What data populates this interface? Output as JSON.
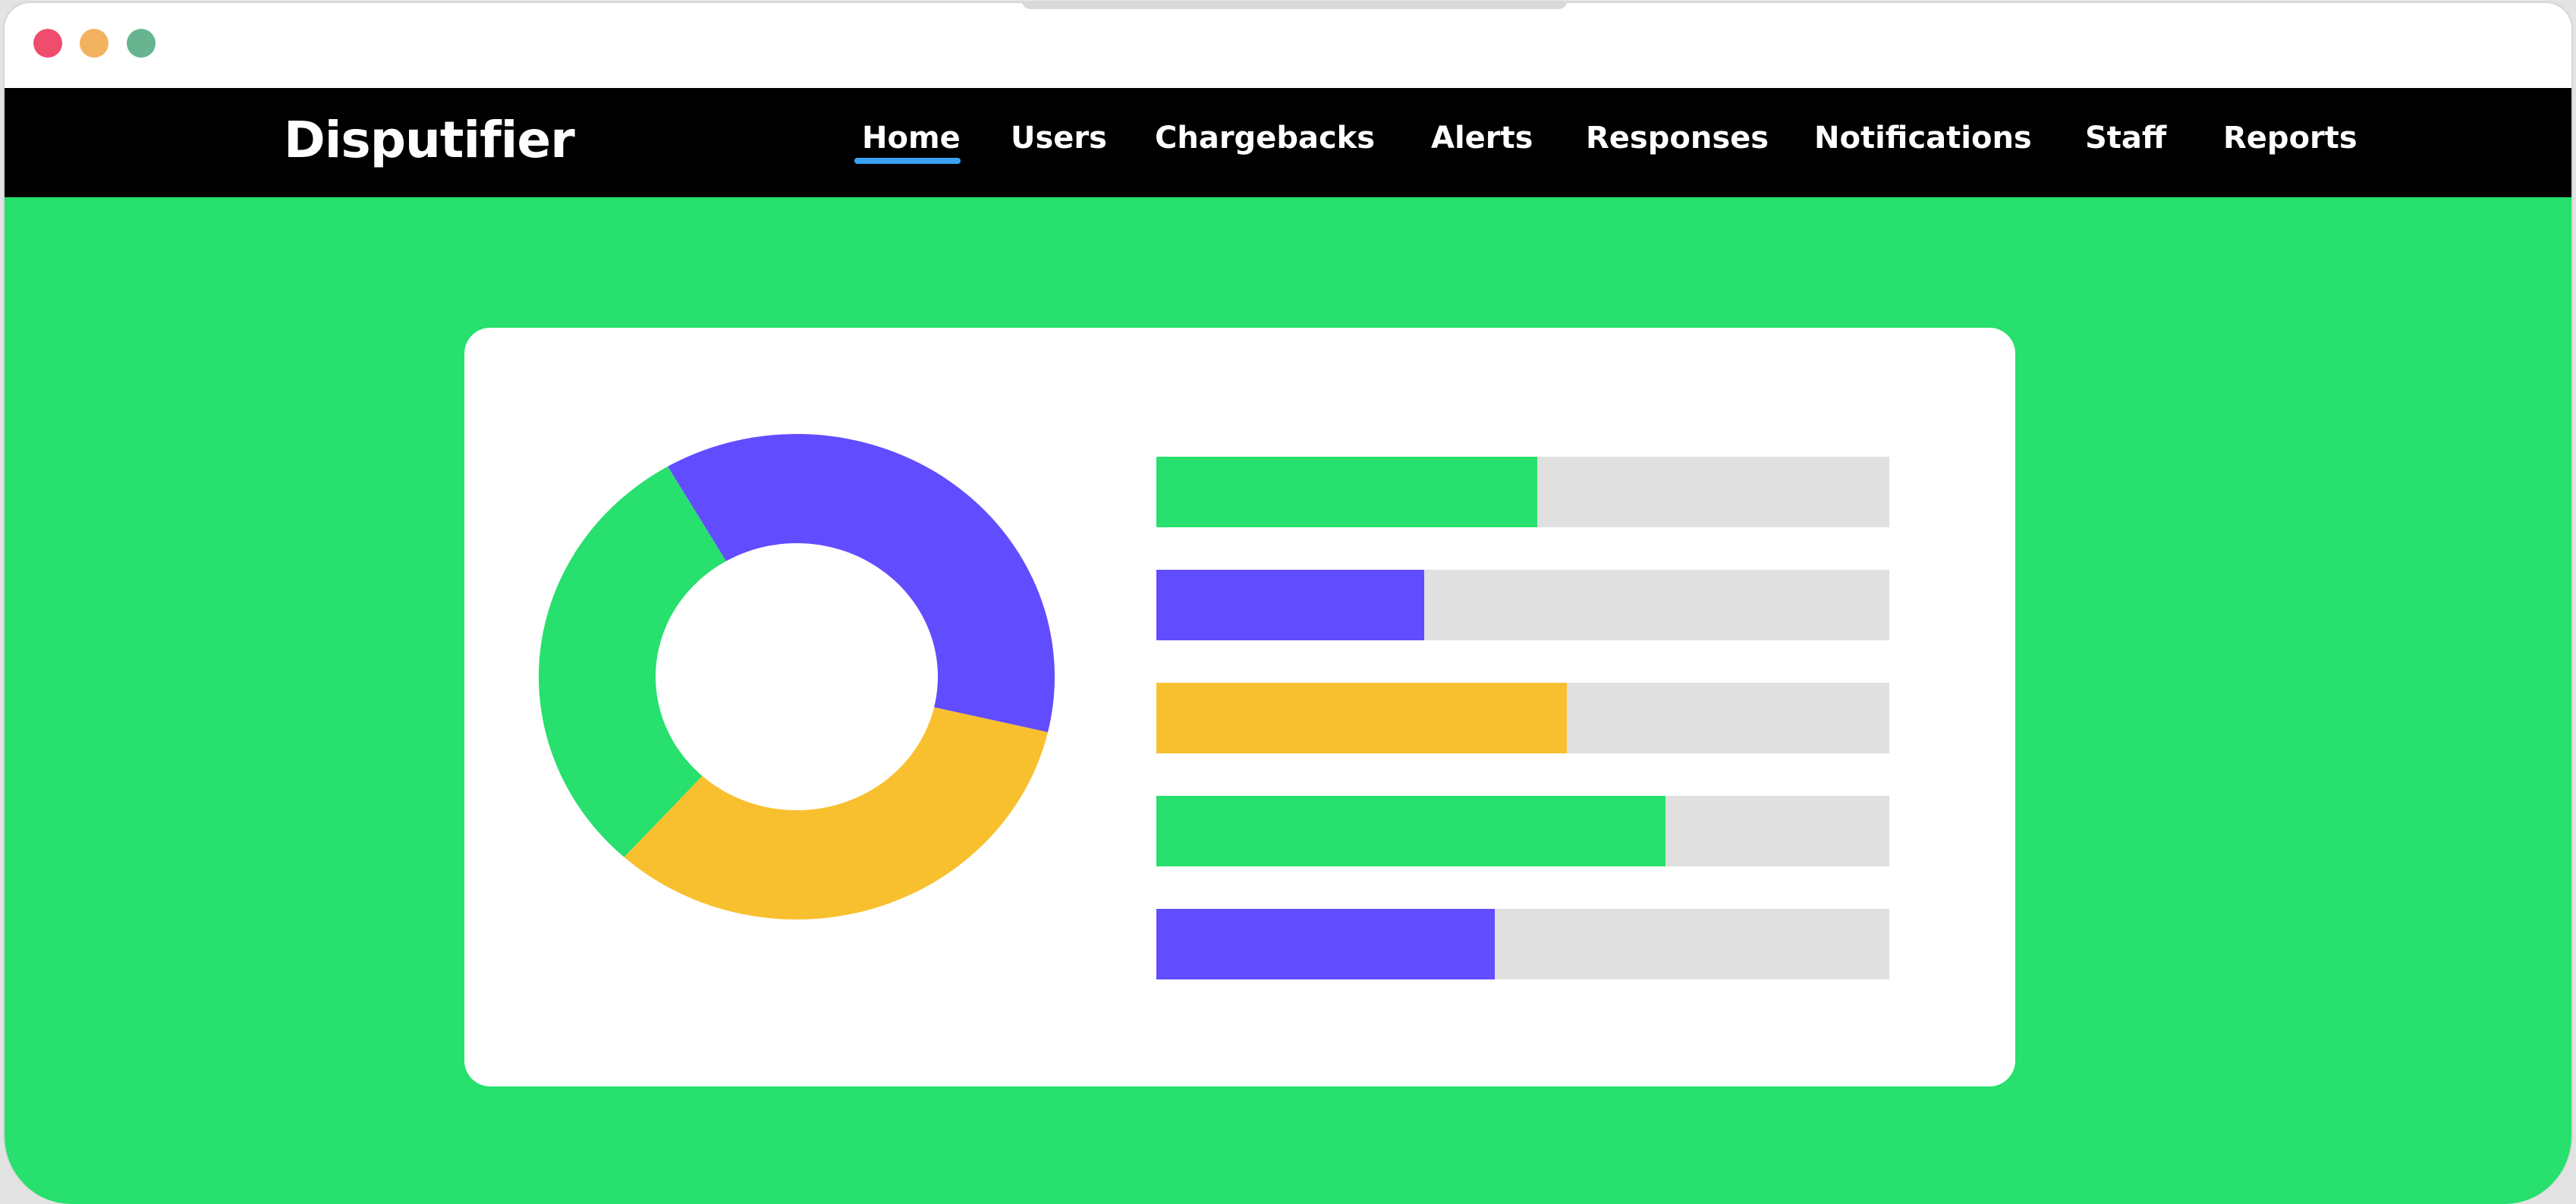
{
  "colors": {
    "page_background": "#27e06d",
    "navbar_background": "#000000",
    "accent_underline": "#3aa2f4",
    "track": "#e0e0e0",
    "green": "#27e06d",
    "purple": "#624cff",
    "yellow": "#f8c02e",
    "window_dot_red": "#ef4c6e",
    "window_dot_yellow": "#f3b260",
    "window_dot_green": "#66b490"
  },
  "window_controls": [
    {
      "name": "close-dot",
      "color": "#ef4c6e"
    },
    {
      "name": "minimize-dot",
      "color": "#f3b260"
    },
    {
      "name": "maximize-dot",
      "color": "#66b490"
    }
  ],
  "brand": "Disputifier",
  "nav": {
    "active": "Home",
    "items": [
      "Home",
      "Users",
      "Chargebacks",
      "Alerts",
      "Responses",
      "Notifications",
      "Staff",
      "Reports"
    ]
  },
  "chart_data": [
    {
      "type": "pie",
      "variant": "donut",
      "slices": [
        {
          "color": "#624cff",
          "value": 37
        },
        {
          "color": "#f8c02e",
          "value": 33
        },
        {
          "color": "#27e06d",
          "value": 30
        }
      ]
    },
    {
      "type": "bar",
      "orientation": "horizontal",
      "bars": [
        {
          "color": "#27e06d",
          "value": 0.52
        },
        {
          "color": "#624cff",
          "value": 0.365
        },
        {
          "color": "#f8c02e",
          "value": 0.56
        },
        {
          "color": "#27e06d",
          "value": 0.695
        },
        {
          "color": "#624cff",
          "value": 0.462
        }
      ]
    }
  ]
}
